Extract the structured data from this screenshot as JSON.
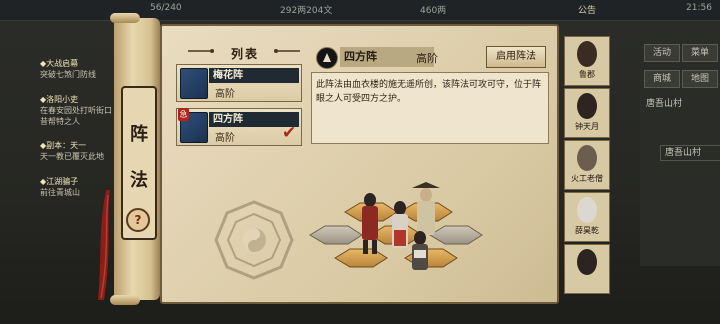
{
  "top_bar": {
    "stamina": "56/240",
    "money": "292两204文",
    "gold": "460两",
    "announcement": "公告",
    "time": "21:56"
  },
  "quests": [
    {
      "title": "◆大战启幕",
      "desc": "突破七煞门防线"
    },
    {
      "title": "◆洛阳小吏",
      "desc": "在春安园处打听街口昔帮特之人"
    },
    {
      "title": "◆副本：天一",
      "desc": "天一教已覆灭此地"
    },
    {
      "title": "◆江湖骗子",
      "desc": "前往青城山"
    }
  ],
  "right_menu": {
    "activity": "活动",
    "menu": "菜单",
    "shop": "商城",
    "map": "地图",
    "location": "唐吾山村",
    "location2": "唐吾山村"
  },
  "scroll_title": [
    "阵",
    "法"
  ],
  "help_label": "?",
  "formation_list": {
    "header": "列表",
    "items": [
      {
        "name": "梅花阵",
        "grade": "高阶",
        "selected": false,
        "new": false
      },
      {
        "name": "四方阵",
        "grade": "高阶",
        "selected": true,
        "new": true
      }
    ],
    "new_tag": "急",
    "check_mark": "✔"
  },
  "detail": {
    "name": "四方阵",
    "grade": "高阶",
    "use_button": "启用阵法",
    "description": "此阵法由血衣楼的施无遥所创，该阵法可攻可守，位于阵眼之人可受四方之护。"
  },
  "team": [
    {
      "name": "鲁郡"
    },
    {
      "name": "钟天月"
    },
    {
      "name": "火工老僧"
    },
    {
      "name": "薛昊乾"
    },
    {
      "name": ""
    }
  ],
  "colors": {
    "accent_red": "#b3261a",
    "parchment": "#e0d1ad"
  }
}
